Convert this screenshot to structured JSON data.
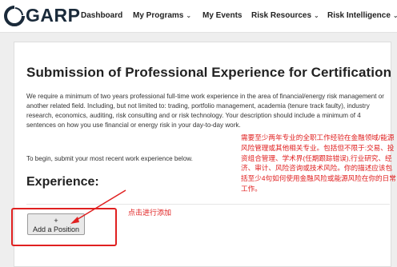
{
  "nav": {
    "logo_text": "GARP",
    "items": [
      {
        "label": "Dashboard",
        "dropdown": false
      },
      {
        "label": "My Programs",
        "dropdown": true
      },
      {
        "label": "My Events",
        "dropdown": false
      },
      {
        "label": "Risk Resources",
        "dropdown": true
      },
      {
        "label": "Risk Intelligence",
        "dropdown": true
      }
    ]
  },
  "page": {
    "title": "Submission of Professional Experience for Certification",
    "description": "We require a minimum of two years professional full-time work experience in the area of financial/energy risk management or another related field. Including, but not limited to: trading, portfolio management, academia (tenure track faulty), industry research, economics, auditing, risk consulting and or risk technology. Your description should include a minimum of 4 sentences on how you use financial or energy risk in your day-to-day work.",
    "instruction": "To begin, submit your most recent work experience below.",
    "experience_heading": "Experience:",
    "add_button_plus": "+",
    "add_button_label": "Add a Position"
  },
  "annotations": {
    "right_note": "需要至少两年专业的全职工作经验在金融领域/能源风险管理或其他相关专业。包括但不限于:交易、投资组合管理、学术界(任期跟踪错误),行业研究、经济、审计、风险咨询或技术风险。你的描述应该包括至少4句如何使用金融风险或能源风险在你的日常工作。",
    "left_note": "点击进行添加",
    "color": "#e02020"
  },
  "colors": {
    "nav_background": "#ffffff",
    "page_background": "#eeeeee",
    "annotation_red": "#e02020"
  }
}
